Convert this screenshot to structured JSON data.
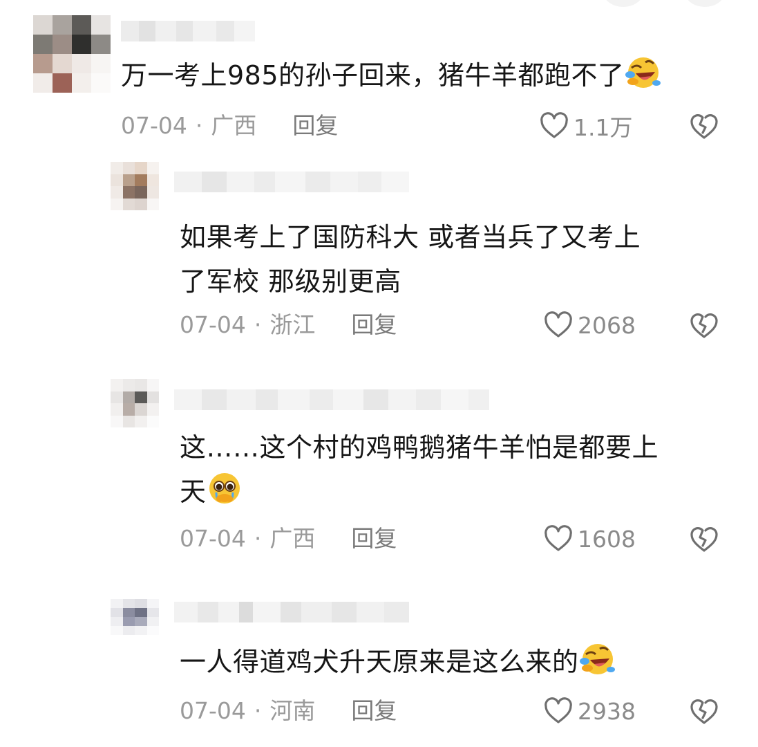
{
  "comments": [
    {
      "text": "万一考上985的孙子回来，猪牛羊都跑不了",
      "emoji": "rolling-on-floor-laughing-emoji",
      "date": "07-04",
      "dot": "·",
      "location": "广西",
      "reply": "回复",
      "likes": "1.1万"
    },
    {
      "line1": "如果考上了国防科大 或者当兵了又考上",
      "line2": "了军校 那级别更高",
      "date": "07-04",
      "dot": "·",
      "location": "浙江",
      "reply": "回复",
      "likes": "2068"
    },
    {
      "line1": "这……这个村的鸡鸭鹅猪牛羊怕是都要上",
      "line2": "天",
      "emoji": "pleading-face-emoji",
      "date": "07-04",
      "dot": "·",
      "location": "广西",
      "reply": "回复",
      "likes": "1608"
    },
    {
      "text": "一人得道鸡犬升天原来是这么来的",
      "emoji": "rolling-on-floor-laughing-emoji",
      "date": "07-04",
      "dot": "·",
      "location": "河南",
      "reply": "回复",
      "likes": "2938"
    }
  ],
  "icons": {
    "like": "heart-outline-icon",
    "dislike": "broken-heart-icon"
  },
  "colors": {
    "text": "#161616",
    "meta": "#9a9a9a",
    "reply": "#7a7a7a",
    "icon": "#6f6f6f"
  }
}
